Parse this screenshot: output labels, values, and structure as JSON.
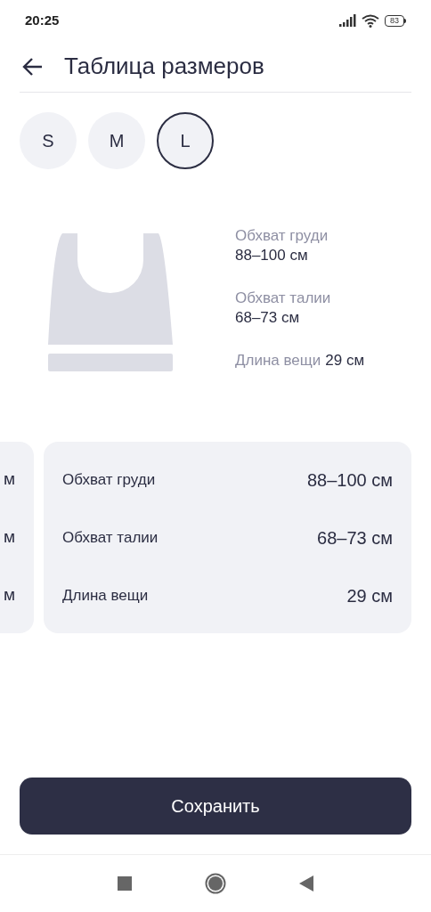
{
  "status_bar": {
    "time": "20:25",
    "battery": "83"
  },
  "header": {
    "title": "Таблица размеров"
  },
  "sizes": [
    {
      "label": "S",
      "selected": false
    },
    {
      "label": "M",
      "selected": false
    },
    {
      "label": "L",
      "selected": true
    }
  ],
  "summary": [
    {
      "label": "Обхват груди",
      "value": "88–100 см",
      "inline": false
    },
    {
      "label": "Обхват талии",
      "value": "68–73 см",
      "inline": false
    },
    {
      "label": "Длина вещи",
      "value": "29 см",
      "inline": true
    }
  ],
  "previous_card": {
    "values": [
      "м",
      "м",
      "м"
    ]
  },
  "card": {
    "rows": [
      {
        "label": "Обхват груди",
        "value": "88–100 см"
      },
      {
        "label": "Обхват талии",
        "value": "68–73 см"
      },
      {
        "label": "Длина вещи",
        "value": "29 см"
      }
    ]
  },
  "save_button": "Сохранить"
}
